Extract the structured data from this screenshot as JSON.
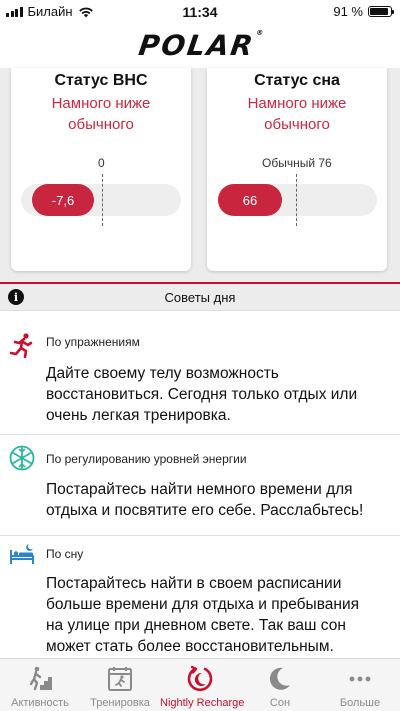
{
  "status_bar": {
    "carrier": "Билайн",
    "time": "11:34",
    "battery": "91 %",
    "battery_level": 0.91
  },
  "header": {
    "logo": "POLAR"
  },
  "cards": {
    "ans": {
      "title": "Статус ВНС",
      "status": "Намного ниже обычного",
      "reference_label": "0",
      "value_label": "-7,6",
      "value": -7.6
    },
    "sleep": {
      "title": "Статус сна",
      "status": "Намного ниже обычного",
      "reference_label": "Обычный 76",
      "value_label": "66",
      "value": 66,
      "reference": 76
    }
  },
  "tips": {
    "header": "Советы дня",
    "items": [
      {
        "icon": "running-icon",
        "category": "По упражнениям",
        "text": "Дайте своему телу возможность восстановиться. Сегодня только отдых или очень легкая тренировка."
      },
      {
        "icon": "energy-icon",
        "category": "По регулированию уровней энергии",
        "text": "Постарайтесь найти немного времени для отдыха и посвятите его себе. Расслабьтесь!"
      },
      {
        "icon": "bed-icon",
        "category": "По сну",
        "text": "Постарайтесь найти в своем расписании больше времени для отдыха и пребывания на улице при дневном свете. Так ваш сон может стать более восстановительным."
      }
    ]
  },
  "tabbar": {
    "tabs": [
      {
        "label": "Активность",
        "icon": "activity-icon"
      },
      {
        "label": "Тренировка",
        "icon": "training-icon"
      },
      {
        "label": "Nightly Recharge",
        "icon": "nightly-recharge-icon",
        "active": true
      },
      {
        "label": "Сон",
        "icon": "moon-icon"
      },
      {
        "label": "Больше",
        "icon": "more-icon"
      }
    ]
  },
  "colors": {
    "accent": "#c8102e",
    "status_text": "#d0263e",
    "bar_fill": "#c8263e",
    "inactive_tab": "#8a8a8a"
  }
}
